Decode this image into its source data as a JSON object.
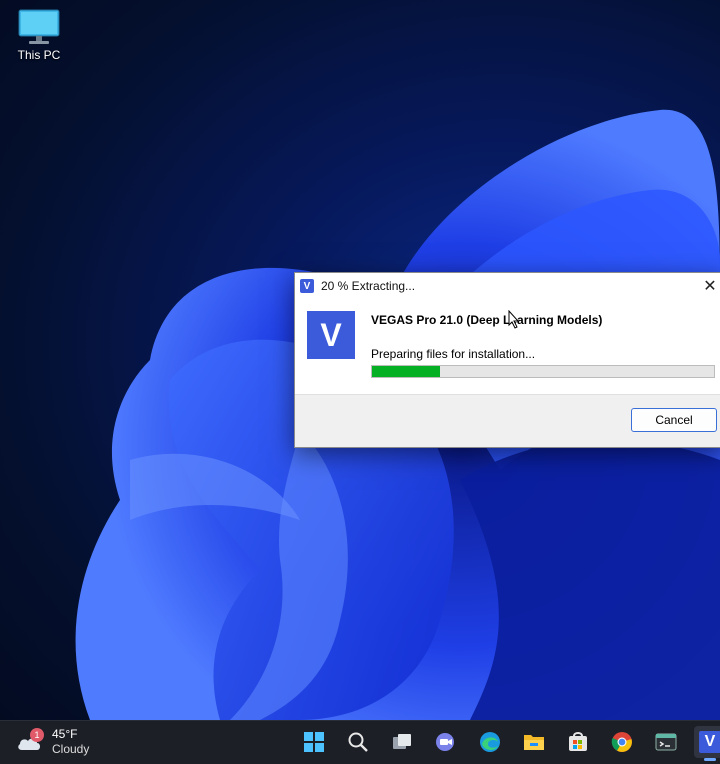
{
  "desktop": {
    "icons": [
      {
        "label": "This PC",
        "icon": "monitor-icon"
      }
    ]
  },
  "dialog": {
    "title": "20 % Extracting...",
    "title_icon_letter": "V",
    "app_logo_letter": "V",
    "product_name": "VEGAS Pro 21.0 (Deep Learning Models)",
    "status_text": "Preparing files for installation...",
    "progress_percent": 20,
    "cancel_label": "Cancel",
    "close_glyph": "✕"
  },
  "taskbar": {
    "weather": {
      "notification_count": "1",
      "temperature": "45°F",
      "condition": "Cloudy"
    },
    "apps": [
      {
        "name": "start-icon"
      },
      {
        "name": "search-icon"
      },
      {
        "name": "task-view-icon"
      },
      {
        "name": "teams-chat-icon"
      },
      {
        "name": "edge-icon"
      },
      {
        "name": "file-explorer-icon"
      },
      {
        "name": "microsoft-store-icon"
      },
      {
        "name": "chrome-icon"
      },
      {
        "name": "terminal-icon"
      },
      {
        "name": "vegas-icon",
        "letter": "V",
        "active": true
      }
    ]
  },
  "colors": {
    "accent": "#3b5bdb",
    "progress": "#06b025",
    "taskbar": "#1c1f26"
  }
}
